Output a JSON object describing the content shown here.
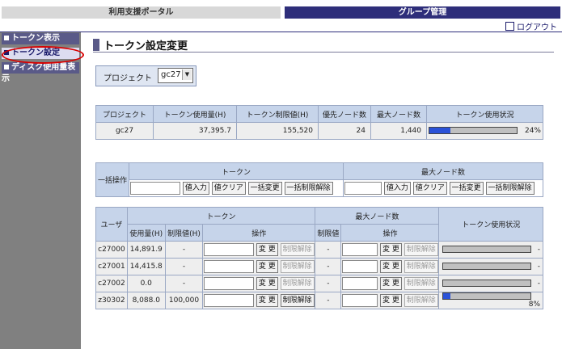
{
  "top_tabs": {
    "portal": "利用支援ポータル",
    "group": "グループ管理"
  },
  "logout_label": "ログアウト",
  "sidebar": {
    "items": [
      {
        "label": "トークン表示"
      },
      {
        "label": "トークン設定"
      },
      {
        "label": "ディスク使用量表示"
      }
    ]
  },
  "page_title": "トークン設定変更",
  "project_selector": {
    "label": "プロジェクト",
    "value": "gc27"
  },
  "summary": {
    "headers": [
      "プロジェクト",
      "トークン使用量(H)",
      "トークン制限値(H)",
      "優先ノード数",
      "最大ノード数",
      "トークン使用状況"
    ],
    "row": {
      "project": "gc27",
      "used": "37,395.7",
      "limit": "155,520",
      "priority_nodes": "24",
      "max_nodes": "1,440",
      "usage_pct": "24%",
      "usage_fraction": 0.24
    }
  },
  "bulk": {
    "label": "一括操作",
    "token_header": "トークン",
    "nodes_header": "最大ノード数",
    "buttons": {
      "input": "値入力",
      "clear": "値クリア",
      "change_all": "一括変更",
      "release_all": "一括制限解除"
    }
  },
  "users": {
    "header_user": "ユーザ",
    "header_token": "トークン",
    "header_nodes": "最大ノード数",
    "header_status": "トークン使用状況",
    "sub_used": "使用量(H)",
    "sub_limit": "制限値(H)",
    "sub_op": "操作",
    "sub_node_limit": "制限値",
    "sub_node_op": "操作",
    "btn_change": "変 更",
    "btn_release": "制限解除",
    "rows": [
      {
        "user": "c27000",
        "used": "14,891.9",
        "limit": "-",
        "node_limit": "-",
        "pct": "-",
        "fraction": 0,
        "release_enabled": false
      },
      {
        "user": "c27001",
        "used": "14,415.8",
        "limit": "-",
        "node_limit": "-",
        "pct": "-",
        "fraction": 0,
        "release_enabled": false
      },
      {
        "user": "c27002",
        "used": "0.0",
        "limit": "-",
        "node_limit": "-",
        "pct": "-",
        "fraction": 0,
        "release_enabled": false
      },
      {
        "user": "z30302",
        "used": "8,088.0",
        "limit": "100,000",
        "node_limit": "-",
        "pct": "8%",
        "fraction": 0.08,
        "release_enabled": true
      }
    ]
  },
  "colors": {
    "accent": "#2e2e7a",
    "header_bg": "#c6d4ea",
    "bar_fill": "#2a52d8",
    "highlight": "#d80000"
  }
}
